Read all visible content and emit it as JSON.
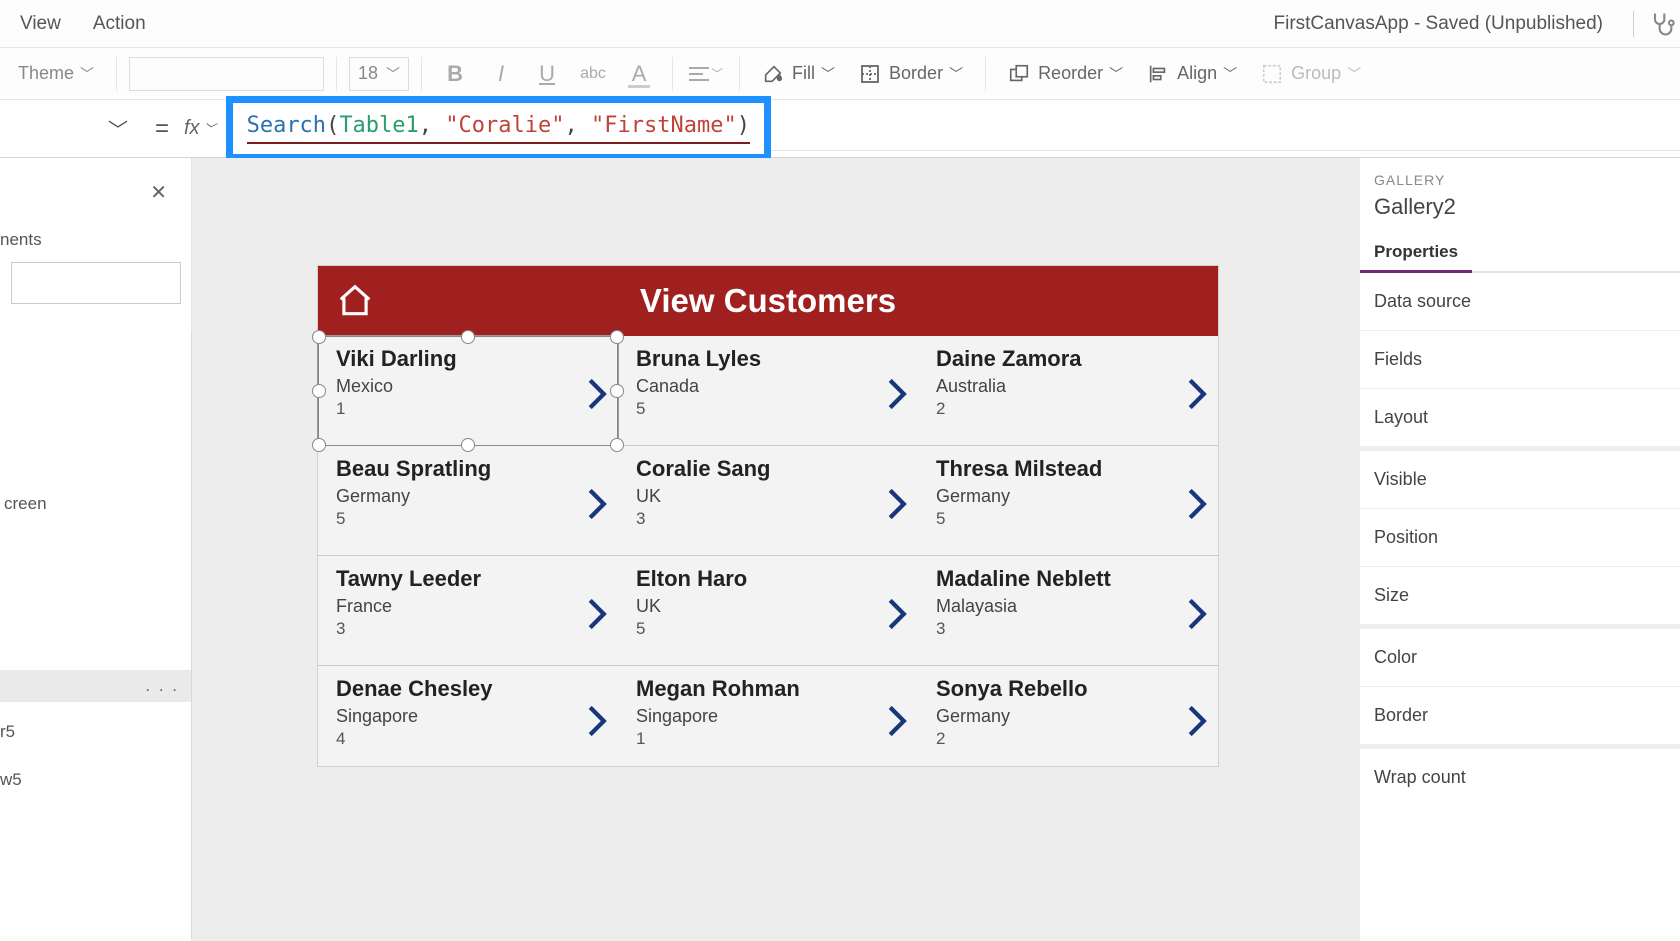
{
  "header": {
    "menu_view": "View",
    "menu_action": "Action",
    "app_status": "FirstCanvasApp - Saved (Unpublished)"
  },
  "toolbar": {
    "theme_label": "Theme",
    "font_size": "18",
    "fill_label": "Fill",
    "border_label": "Border",
    "reorder_label": "Reorder",
    "align_label": "Align",
    "group_label": "Group"
  },
  "formula": {
    "fn": "Search",
    "ident": "Table1",
    "arg2": "\"Coralie\"",
    "arg3": "\"FirstName\"",
    "open": "(",
    "comma": ", ",
    "close": ")",
    "equals": "=",
    "fx": "fx"
  },
  "left_panel": {
    "heading_fragment": "nents",
    "screen_fragment": "creen",
    "item_r5": "r5",
    "item_w5": "w5"
  },
  "device": {
    "title": "View Customers"
  },
  "gallery_grid": [
    [
      {
        "name": "Viki  Darling",
        "country": "Mexico",
        "num": "1"
      },
      {
        "name": "Bruna  Lyles",
        "country": "Canada",
        "num": "5"
      },
      {
        "name": "Daine  Zamora",
        "country": "Australia",
        "num": "2"
      }
    ],
    [
      {
        "name": "Beau  Spratling",
        "country": "Germany",
        "num": "5"
      },
      {
        "name": "Coralie  Sang",
        "country": "UK",
        "num": "3"
      },
      {
        "name": "Thresa  Milstead",
        "country": "Germany",
        "num": "5"
      }
    ],
    [
      {
        "name": "Tawny  Leeder",
        "country": "France",
        "num": "3"
      },
      {
        "name": "Elton  Haro",
        "country": "UK",
        "num": "5"
      },
      {
        "name": "Madaline  Neblett",
        "country": "Malayasia",
        "num": "3"
      }
    ],
    [
      {
        "name": "Denae  Chesley",
        "country": "Singapore",
        "num": "4"
      },
      {
        "name": "Megan  Rohman",
        "country": "Singapore",
        "num": "1"
      },
      {
        "name": "Sonya  Rebello",
        "country": "Germany",
        "num": "2"
      }
    ]
  ],
  "right_panel": {
    "category": "GALLERY",
    "name": "Gallery2",
    "tab_properties": "Properties",
    "props": {
      "data_source": "Data source",
      "fields": "Fields",
      "layout": "Layout",
      "visible": "Visible",
      "position": "Position",
      "size": "Size",
      "color": "Color",
      "border": "Border",
      "wrap_count": "Wrap count"
    }
  }
}
